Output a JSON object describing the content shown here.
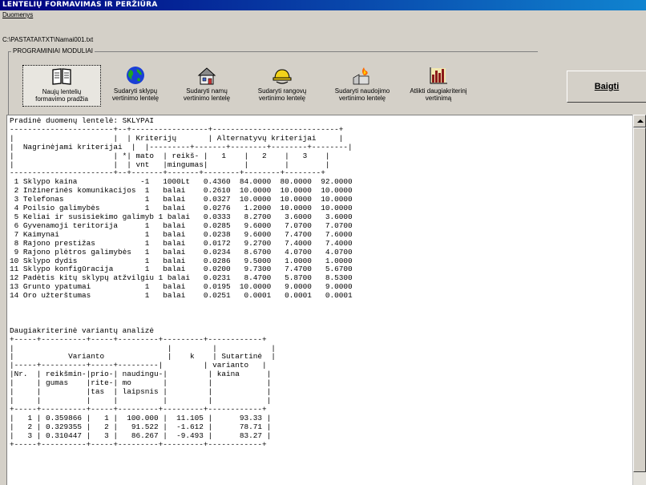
{
  "window": {
    "title": "LENTELIŲ FORMAVIMAS IR PERŽIŪRA"
  },
  "menu": {
    "items": [
      "Duomenys"
    ]
  },
  "file_path": "C:\\PASTATAI\\TXT\\Namai001.txt",
  "modules": {
    "group_label": "PROGRAMINIAI MODULIAI",
    "buttons": [
      {
        "line1": "Naujų lentelių",
        "line2": "formavimo pradžia",
        "icon": "book-icon"
      },
      {
        "line1": "Sudaryti sklypų",
        "line2": "vertinimo lentelę",
        "icon": "globe-icon"
      },
      {
        "line1": "Sudaryti namų",
        "line2": "vertinimo lentelę",
        "icon": "house-icon"
      },
      {
        "line1": "Sudaryti rangovų",
        "line2": "vertinimo lentelę",
        "icon": "hardhat-icon"
      },
      {
        "line1": "Sudaryti naudojimo",
        "line2": "vertinimo lentelę",
        "icon": "fire-house-icon"
      },
      {
        "line1": "Atlikti daugiakriterinį",
        "line2": "vertinimą",
        "icon": "bar-chart-icon"
      }
    ]
  },
  "exit_button": "Baigti",
  "report": {
    "text": "Pradinė duomenų lentelė: SKLYPAI\n-----------------------+--+-----------------+----------------------------+\n|                      |  | Kriterijų       | Alternatyvų kriterijai     |\n|  Nagrinėjami kriterijai  |  |---------+-------+--------+--------+--------|\n|                      | *| mato  | reikš- |   1    |   2    |   3    |\n|                      |  | vnt   |mingumas|        |        |        |\n-----------------------+--+-------+-------+--------+--------+--------+\n 1 Sklypo kaina              -1   1000Lt   0.4360  84.0000  80.0000  92.0000\n 2 Inžinerinės komunikacijos  1   balai    0.2610  10.0000  10.0000  10.0000\n 3 Telefonas                  1   balai    0.0327  10.0000  10.0000  10.0000\n 4 Poilsio galimybės          1   balai    0.0276   1.2000  10.0000  10.0000\n 5 Keliai ir susisiekimo galimyb 1 balai   0.0333   8.2700   3.6000   3.6000\n 6 Gyvenamoji teritorija      1   balai    0.0285   9.6000   7.0700   7.0700\n 7 Kaimynai                   1   balai    0.0238   9.6000   7.4700   7.6000\n 8 Rajono prestižas           1   balai    0.0172   9.2700   7.4000   7.4000\n 9 Rajono plėtros galimybės   1   balai    0.0234   8.6700   4.0700   4.0700\n10 Sklypo dydis               1   balai    0.0286   9.5000   1.0000   1.0000\n11 Sklypo konfigūracija       1   balai    0.0200   9.7300   7.4700   5.6700\n12 Padėtis kitų sklypų atžvilgiu 1 balai   0.0231   8.4700   5.8700   8.5300\n13 Grunto ypatumai            1   balai    0.0195  10.0000   9.0000   9.0000\n14 Oro užterštumas            1   balai    0.0251   0.0001   0.0001   0.0001\n\n\n\nDaugiakriterinė variantų analizė\n+-----+----------+-----+---------+---------+------------+\n|                                  |         |            |\n|            Varianto              |    k    | Sutartinė  |\n|-----+----------+-----+---------|         | varianto   |\n|Nr.  | reikšmin-|prio-| naudingu-|         | kaina      |\n|     | gumas    |rite-| mo       |         |            |\n|     |          |tas  | laipsnis |         |            |\n|     |          |     |          |         |            |\n+-----+----------+-----+---------+---------+------------+\n|   1 | 0.359866 |   1 |  100.000 |  11.105 |      93.33 |\n|   2 | 0.329355 |   2 |   91.522 |  -1.612 |      78.71 |\n|   3 | 0.310447 |   3 |   86.267 |  -9.493 |      83.27 |\n+-----+----------+-----+---------+---------+------------+"
  }
}
